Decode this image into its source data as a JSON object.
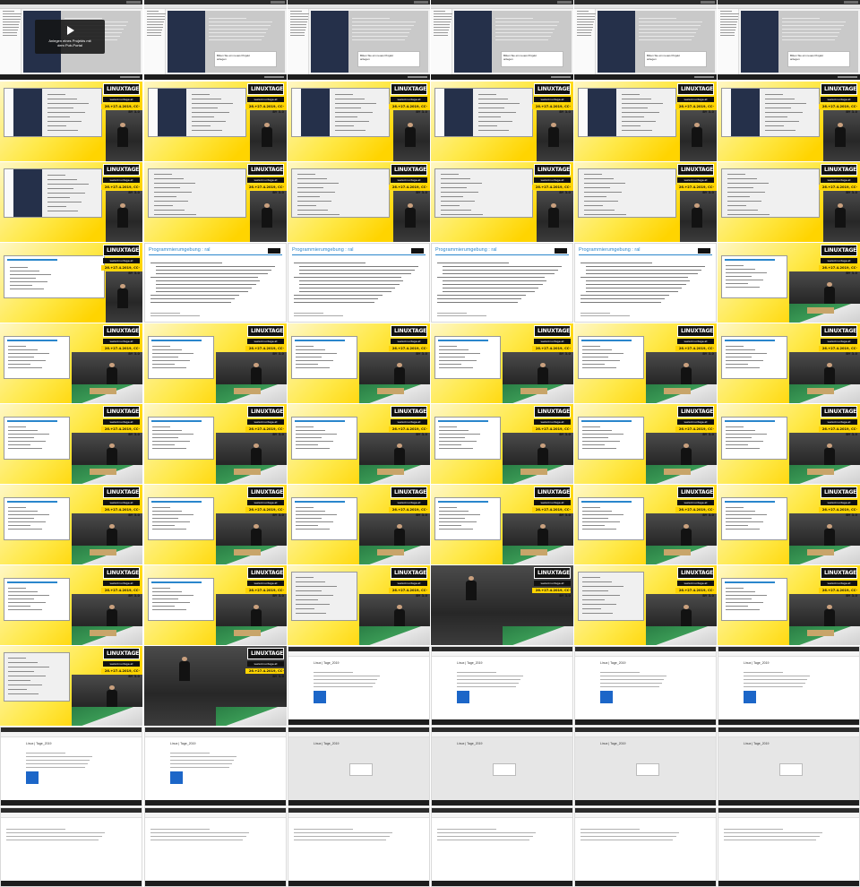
{
  "video_overlay": {
    "caption_line1": "Anlegen eines Projekts mit",
    "caption_line2": "dem Pub-Portal"
  },
  "dialog": {
    "line1": "Bitten Sie ein neues Projekt",
    "line2": "anlegen"
  },
  "conference": {
    "logo": "LINUXTAGE",
    "url": "www.linuxtage.at",
    "date": "26.+27.4.2019, CC-BY 3.0"
  },
  "slide": {
    "title": "Programmierumgebung : ral"
  },
  "web": {
    "title": "Linux | Tage_2019"
  },
  "rows": [
    [
      "screen-video",
      "screen-dialog",
      "screen-dialog",
      "screen-dialog",
      "screen-dialog",
      "screen-dialog"
    ],
    [
      "conf-screen",
      "conf-screen",
      "conf-screen",
      "conf-screen",
      "conf-screen",
      "conf-screen"
    ],
    [
      "conf-screen",
      "conf-code",
      "conf-code",
      "conf-code",
      "conf-code",
      "conf-code"
    ],
    [
      "conf-slide-small",
      "slide",
      "slide",
      "slide",
      "slide",
      "conf-slide-cam"
    ],
    [
      "conf-slide-cam",
      "conf-slide-cam",
      "conf-slide-cam",
      "conf-slide-cam",
      "conf-slide-cam",
      "conf-slide-cam"
    ],
    [
      "conf-slide-cam",
      "conf-slide-cam",
      "conf-slide-cam",
      "conf-slide-cam",
      "conf-slide-cam",
      "conf-slide-cam"
    ],
    [
      "conf-slide-cam",
      "conf-slide-cam",
      "conf-slide-cam",
      "conf-slide-cam",
      "conf-slide-cam",
      "conf-slide-cam"
    ],
    [
      "conf-slide-cam",
      "conf-slide-cam",
      "conf-code-cam",
      "conf-cam",
      "conf-code-cam",
      "conf-slide-cam"
    ],
    [
      "conf-code-cam",
      "conf-cam",
      "web",
      "web",
      "web",
      "web"
    ],
    [
      "web",
      "web",
      "web-grey",
      "web-grey",
      "web-grey",
      "web-grey"
    ],
    [
      "web-plain",
      "web-plain",
      "web-plain",
      "web-plain",
      "web-plain",
      "web-plain"
    ]
  ]
}
